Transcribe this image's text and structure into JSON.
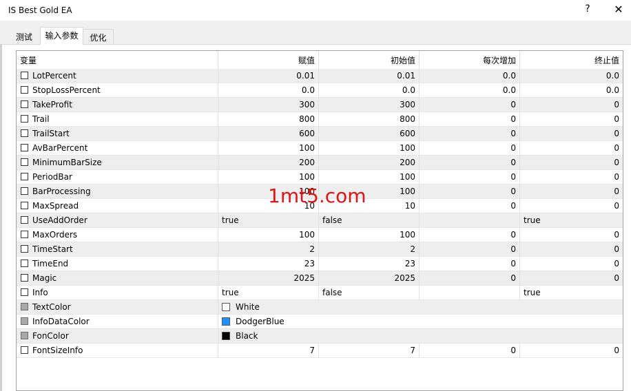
{
  "window": {
    "title": "IS Best Gold EA",
    "help": "?",
    "close": "✕"
  },
  "tabs": [
    {
      "label": "测试"
    },
    {
      "label": "输入参数"
    },
    {
      "label": "优化"
    }
  ],
  "table": {
    "columns": [
      "变量",
      "赋值",
      "初始值",
      "每次增加",
      "终止值"
    ],
    "rows": [
      {
        "name": "LotPercent",
        "value": "0.01",
        "start": "0.01",
        "step": "0.0",
        "stop": "0.0",
        "checkbox": "enabled"
      },
      {
        "name": "StopLossPercent",
        "value": "0.0",
        "start": "0.0",
        "step": "0.0",
        "stop": "0.0",
        "checkbox": "enabled"
      },
      {
        "name": "TakeProfit",
        "value": "300",
        "start": "300",
        "step": "0",
        "stop": "0",
        "checkbox": "enabled"
      },
      {
        "name": "Trail",
        "value": "800",
        "start": "800",
        "step": "0",
        "stop": "0",
        "checkbox": "enabled"
      },
      {
        "name": "TrailStart",
        "value": "600",
        "start": "600",
        "step": "0",
        "stop": "0",
        "checkbox": "enabled"
      },
      {
        "name": "AvBarPercent",
        "value": "100",
        "start": "100",
        "step": "0",
        "stop": "0",
        "checkbox": "enabled"
      },
      {
        "name": "MinimumBarSize",
        "value": "200",
        "start": "200",
        "step": "0",
        "stop": "0",
        "checkbox": "enabled"
      },
      {
        "name": "PeriodBar",
        "value": "100",
        "start": "100",
        "step": "0",
        "stop": "0",
        "checkbox": "enabled"
      },
      {
        "name": "BarProcessing",
        "value": "100",
        "start": "100",
        "step": "0",
        "stop": "0",
        "checkbox": "enabled"
      },
      {
        "name": "MaxSpread",
        "value": "10",
        "start": "10",
        "step": "0",
        "stop": "0",
        "checkbox": "enabled"
      },
      {
        "name": "UseAddOrder",
        "value": "true",
        "start": "false",
        "step": "",
        "stop": "true",
        "checkbox": "enabled",
        "bool": true
      },
      {
        "name": "MaxOrders",
        "value": "100",
        "start": "100",
        "step": "0",
        "stop": "0",
        "checkbox": "enabled"
      },
      {
        "name": "TimeStart",
        "value": "2",
        "start": "2",
        "step": "0",
        "stop": "0",
        "checkbox": "enabled"
      },
      {
        "name": "TimeEnd",
        "value": "23",
        "start": "23",
        "step": "0",
        "stop": "0",
        "checkbox": "enabled"
      },
      {
        "name": "Magic",
        "value": "2025",
        "start": "2025",
        "step": "0",
        "stop": "0",
        "checkbox": "enabled"
      },
      {
        "name": "Info",
        "value": "true",
        "start": "false",
        "step": "",
        "stop": "true",
        "checkbox": "enabled",
        "bool": true
      },
      {
        "name": "TextColor",
        "value": "White",
        "swatch": "#ffffff",
        "checkbox": "disabled",
        "color": true
      },
      {
        "name": "InfoDataColor",
        "value": "DodgerBlue",
        "swatch": "#1e90ff",
        "checkbox": "disabled",
        "color": true
      },
      {
        "name": "FonColor",
        "value": "Black",
        "swatch": "#000000",
        "checkbox": "disabled",
        "color": true
      },
      {
        "name": "FontSizeInfo",
        "value": "7",
        "start": "7",
        "step": "0",
        "stop": "0",
        "checkbox": "enabled"
      }
    ]
  },
  "watermark": "1mt5.com"
}
